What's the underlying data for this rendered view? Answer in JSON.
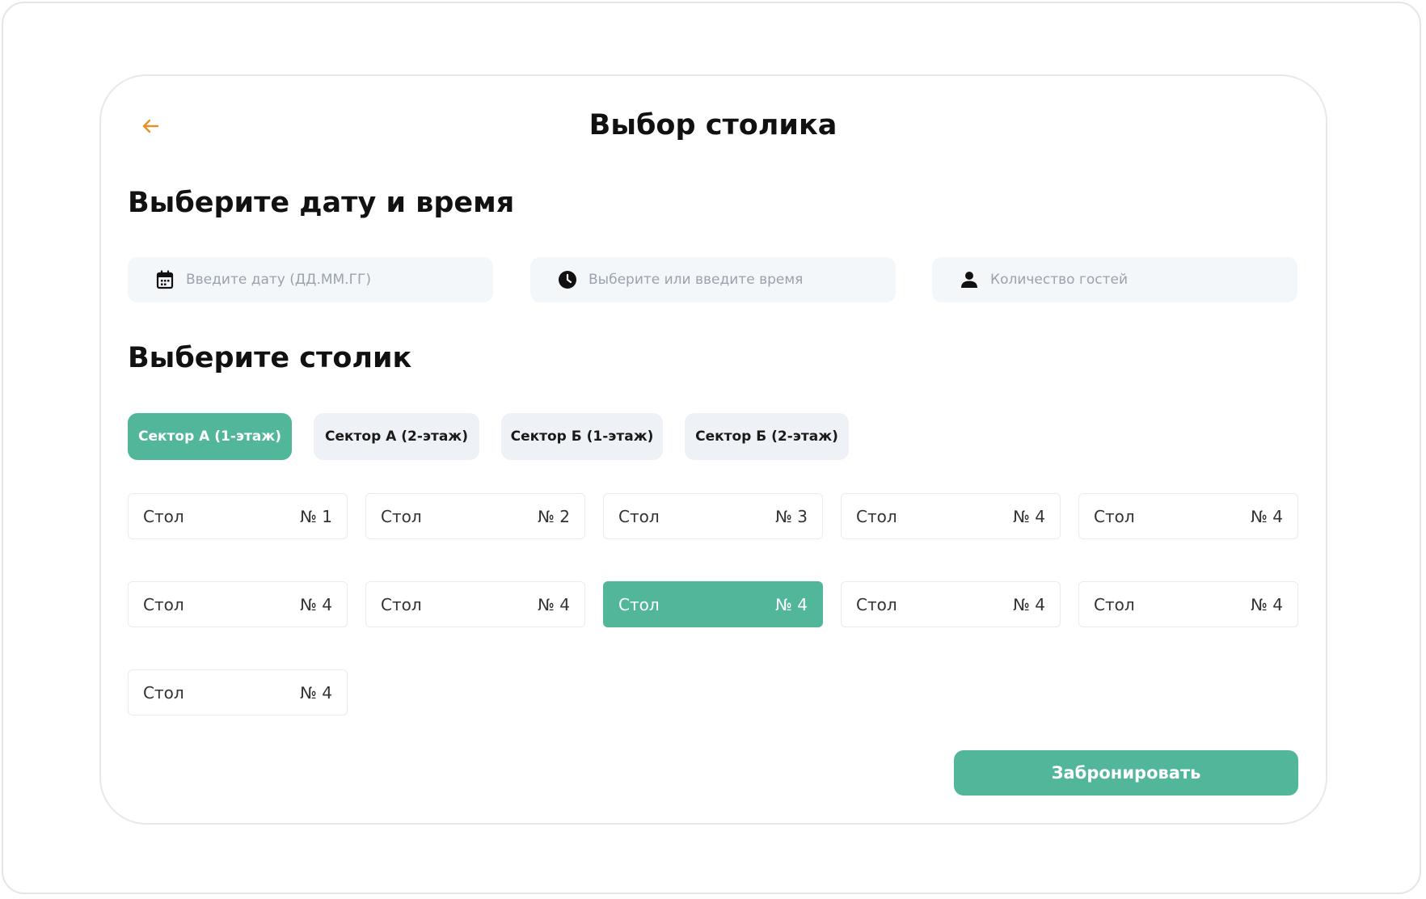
{
  "header": {
    "title": "Выбор столика",
    "back_icon": "arrow-left-icon",
    "accent_color": "#E8912C"
  },
  "datetime_section": {
    "title": "Выберите дату и время",
    "date_field": {
      "value": "",
      "placeholder": "Введите дату (ДД.ММ.ГГ)",
      "icon": "calendar-icon"
    },
    "time_field": {
      "value": "",
      "placeholder": "Выберите или введите время",
      "icon": "clock-icon"
    },
    "guests_field": {
      "value": "",
      "placeholder": "Количество гостей",
      "icon": "user-icon"
    }
  },
  "table_section": {
    "title": "Выберите столик",
    "sectors": [
      {
        "label": "Сектор А (1-этаж)",
        "active": true
      },
      {
        "label": "Сектор А (2-этаж)",
        "active": false
      },
      {
        "label": "Сектор Б (1-этаж)",
        "active": false
      },
      {
        "label": "Сектор Б (2-этаж)",
        "active": false
      }
    ],
    "tables": [
      {
        "label": "Стол",
        "number": "№ 1",
        "selected": false
      },
      {
        "label": "Стол",
        "number": "№ 2",
        "selected": false
      },
      {
        "label": "Стол",
        "number": "№ 3",
        "selected": false
      },
      {
        "label": "Стол",
        "number": "№ 4",
        "selected": false
      },
      {
        "label": "Стол",
        "number": "№ 4",
        "selected": false
      },
      {
        "label": "Стол",
        "number": "№ 4",
        "selected": false
      },
      {
        "label": "Стол",
        "number": "№ 4",
        "selected": false
      },
      {
        "label": "Стол",
        "number": "№ 4",
        "selected": true
      },
      {
        "label": "Стол",
        "number": "№ 4",
        "selected": false
      },
      {
        "label": "Стол",
        "number": "№ 4",
        "selected": false
      },
      {
        "label": "Стол",
        "number": "№ 4",
        "selected": false
      }
    ]
  },
  "actions": {
    "book_label": "Забронировать"
  },
  "colors": {
    "primary": "#52B79A",
    "field_bg": "#F4F7FA",
    "sector_bg": "#EEF2F6"
  }
}
